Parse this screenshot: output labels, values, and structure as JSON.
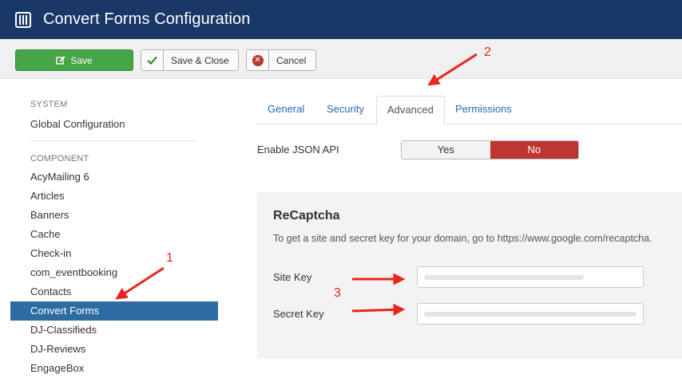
{
  "header": {
    "title": "Convert Forms Configuration",
    "icon": "sliders-icon"
  },
  "toolbar": {
    "save_label": "Save",
    "save_close_label": "Save & Close",
    "cancel_label": "Cancel",
    "save_color": "#46a546",
    "cancel_color": "#bd362f"
  },
  "sidebar": {
    "system_header": "SYSTEM",
    "global_config": "Global Configuration",
    "component_header": "COMPONENT",
    "items": [
      {
        "label": "AcyMailing 6"
      },
      {
        "label": "Articles"
      },
      {
        "label": "Banners"
      },
      {
        "label": "Cache"
      },
      {
        "label": "Check-in"
      },
      {
        "label": "com_eventbooking"
      },
      {
        "label": "Contacts"
      },
      {
        "label": "Convert Forms",
        "active": true
      },
      {
        "label": "DJ-Classifieds"
      },
      {
        "label": "DJ-Reviews"
      },
      {
        "label": "EngageBox"
      }
    ]
  },
  "tabs": [
    {
      "label": "General"
    },
    {
      "label": "Security"
    },
    {
      "label": "Advanced",
      "active": true
    },
    {
      "label": "Permissions"
    }
  ],
  "json_api": {
    "label": "Enable JSON API",
    "yes": "Yes",
    "no": "No",
    "selected": "No"
  },
  "recaptcha": {
    "title": "ReCaptcha",
    "description": "To get a site and secret key for your domain, go to https://www.google.com/recaptcha.",
    "site_key_label": "Site Key",
    "secret_key_label": "Secret Key"
  },
  "annotations": {
    "n1": "1",
    "n2": "2",
    "n3": "3",
    "color": "#e8261c"
  }
}
